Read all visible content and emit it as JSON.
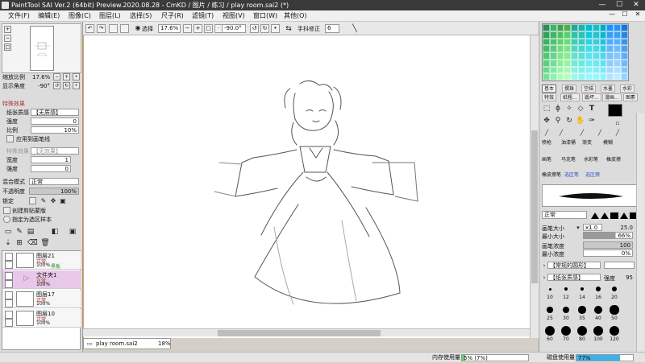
{
  "window": {
    "title": "PaintTool SAI Ver.2 (64bit) Preview.2020.08.28 - CmKD / 图片 / 练习 / play room.sai2 (*)",
    "minimize": "—",
    "maximize": "☐",
    "close": "✕"
  },
  "menu": {
    "items": [
      "文件(F)",
      "编辑(E)",
      "图像(C)",
      "图层(L)",
      "选择(S)",
      "尺子(R)",
      "滤镜(T)",
      "视图(V)",
      "窗口(W)",
      "其他(O)"
    ]
  },
  "toolbar": {
    "select_label": "选择",
    "zoom": "17.6%",
    "rotation": "-90.0°",
    "stabilizer_label": "手抖修正",
    "stabilizer_value": "6"
  },
  "navigator": {
    "zoom_label": "缩放比例",
    "zoom_value": "17.6%",
    "angle_label": "显示角度",
    "angle_value": "-90°"
  },
  "effects": {
    "section_title": "特殊效果",
    "texture_label": "纸张质感",
    "texture_value": "【无质感】",
    "strength_label": "强度",
    "strength_value": "0",
    "scale_label": "比例",
    "scale_value": "10%",
    "apply_label": "应用到画笔线",
    "effect_label": "特殊效果",
    "effect_value": "【无效果】",
    "width_label": "宽度",
    "width_value": "1",
    "intensity_label": "强度",
    "intensity_value": "0"
  },
  "layer_props": {
    "blend_label": "混合模式",
    "blend_value": "正常",
    "opacity_label": "不透明度",
    "opacity_value": "100%",
    "lock_label": "锁定",
    "clip_label": "创建剪贴蒙版",
    "sample_label": "指定为选区样本"
  },
  "layers": [
    {
      "name": "图层21",
      "mode": "正常",
      "opacity": "100%",
      "extra": "黑板"
    },
    {
      "name": "文件夹1",
      "mode": "正常",
      "opacity": "100%",
      "extra": ""
    },
    {
      "name": "图层17",
      "mode": "正常",
      "opacity": "100%",
      "extra": ""
    },
    {
      "name": "图层10",
      "mode": "正常",
      "opacity": "100%",
      "extra": ""
    }
  ],
  "document": {
    "tab_name": "play room.sai2",
    "tab_zoom": "18%"
  },
  "status": {
    "memory_label": "内存使用量",
    "memory_value": "5% (7%)",
    "memory_fraction": 0.05,
    "disk_label": "磁盘使用量",
    "disk_value": "77%",
    "disk_fraction": 0.77
  },
  "color_tabs": [
    "基本",
    "撰珠",
    "空结",
    "水墨",
    "水彩",
    "特效",
    "纸粗...",
    "毁坏...",
    "漫画...",
    "图素"
  ],
  "brush_tools": [
    "喷枪",
    "油漆桶",
    "渐变",
    "模糊",
    "画笔",
    "马克笔",
    "水彩笔",
    "橡皮擦",
    "橡皮擦笔",
    "选区笔",
    "选区擦"
  ],
  "brush": {
    "mode": "正常",
    "size_label": "画笔大小",
    "size_multiplier": "x1.0",
    "size_value": "25.0",
    "min_size_label": "最小大小",
    "min_size_value": "66%",
    "density_label": "画笔浓度",
    "density_value": "100",
    "min_density_label": "最小浓度",
    "min_density_value": "0%",
    "shape_label": "【常规的圆形】",
    "texture_label": "【纸张质感】",
    "strength_label": "强度",
    "strength_value": "95"
  },
  "brush_sizes": [
    "10",
    "12",
    "14",
    "16",
    "20",
    "25",
    "30",
    "35",
    "40",
    "50",
    "60",
    "70",
    "80",
    "100",
    "120"
  ],
  "palette_colors": [
    "#2e8b57",
    "#3cb371",
    "#43a047",
    "#4caf50",
    "#26a69a",
    "#20b2aa",
    "#00bcd4",
    "#1eb8c6",
    "#00acc1",
    "#1e90ff",
    "#2196f3",
    "#1976d2",
    "#33a05a",
    "#45b36c",
    "#4fbf5f",
    "#5ccf6a",
    "#33bfa8",
    "#2ac3b6",
    "#16c8dc",
    "#2bc1ce",
    "#10b6cc",
    "#3a9ef5",
    "#3aa2f3",
    "#2a86dc",
    "#3cb063",
    "#50c077",
    "#5ed06d",
    "#6bdc7a",
    "#44cbb5",
    "#36cdc0",
    "#2cd2e4",
    "#3cccd8",
    "#22c0d6",
    "#52abf6",
    "#54afff",
    "#3b94e4",
    "#46bb6b",
    "#5cc883",
    "#6dde7a",
    "#7be48a",
    "#56d6c1",
    "#48d7cb",
    "#44dbea",
    "#4ed6e0",
    "#38cbe0",
    "#66b6f7",
    "#6cbbff",
    "#4da0ec",
    "#52c675",
    "#68d28f",
    "#7ce688",
    "#8aeb98",
    "#68e0cd",
    "#5ae1d6",
    "#5ce3f0",
    "#60dfe8",
    "#4ed6ea",
    "#7ac1f8",
    "#82c7ff",
    "#5eaef3",
    "#5ecf80",
    "#76dc9c",
    "#8cef98",
    "#9af2a7",
    "#7ae8d7",
    "#6ce8df",
    "#72eaf5",
    "#72e7ef",
    "#64e0f2",
    "#8ecdf9",
    "#98d3ff",
    "#70bbf7",
    "#6ad88b",
    "#84e6a8",
    "#9cf6a6",
    "#a9f7b5",
    "#8defe0",
    "#7eefe7",
    "#88f0f8",
    "#86eef5",
    "#7ae9f8",
    "#a2d8fb",
    "#aedfff",
    "#83c8fa",
    "#78e098",
    "#92eeb4",
    "#adfbb5",
    "#b8fbc2",
    "#a0f5e8",
    "#92f4ee",
    "#9ef5fb",
    "#9bf4fa",
    "#90f1fc",
    "#b5e2fc",
    "#c2e9ff",
    "#96d4fc"
  ]
}
